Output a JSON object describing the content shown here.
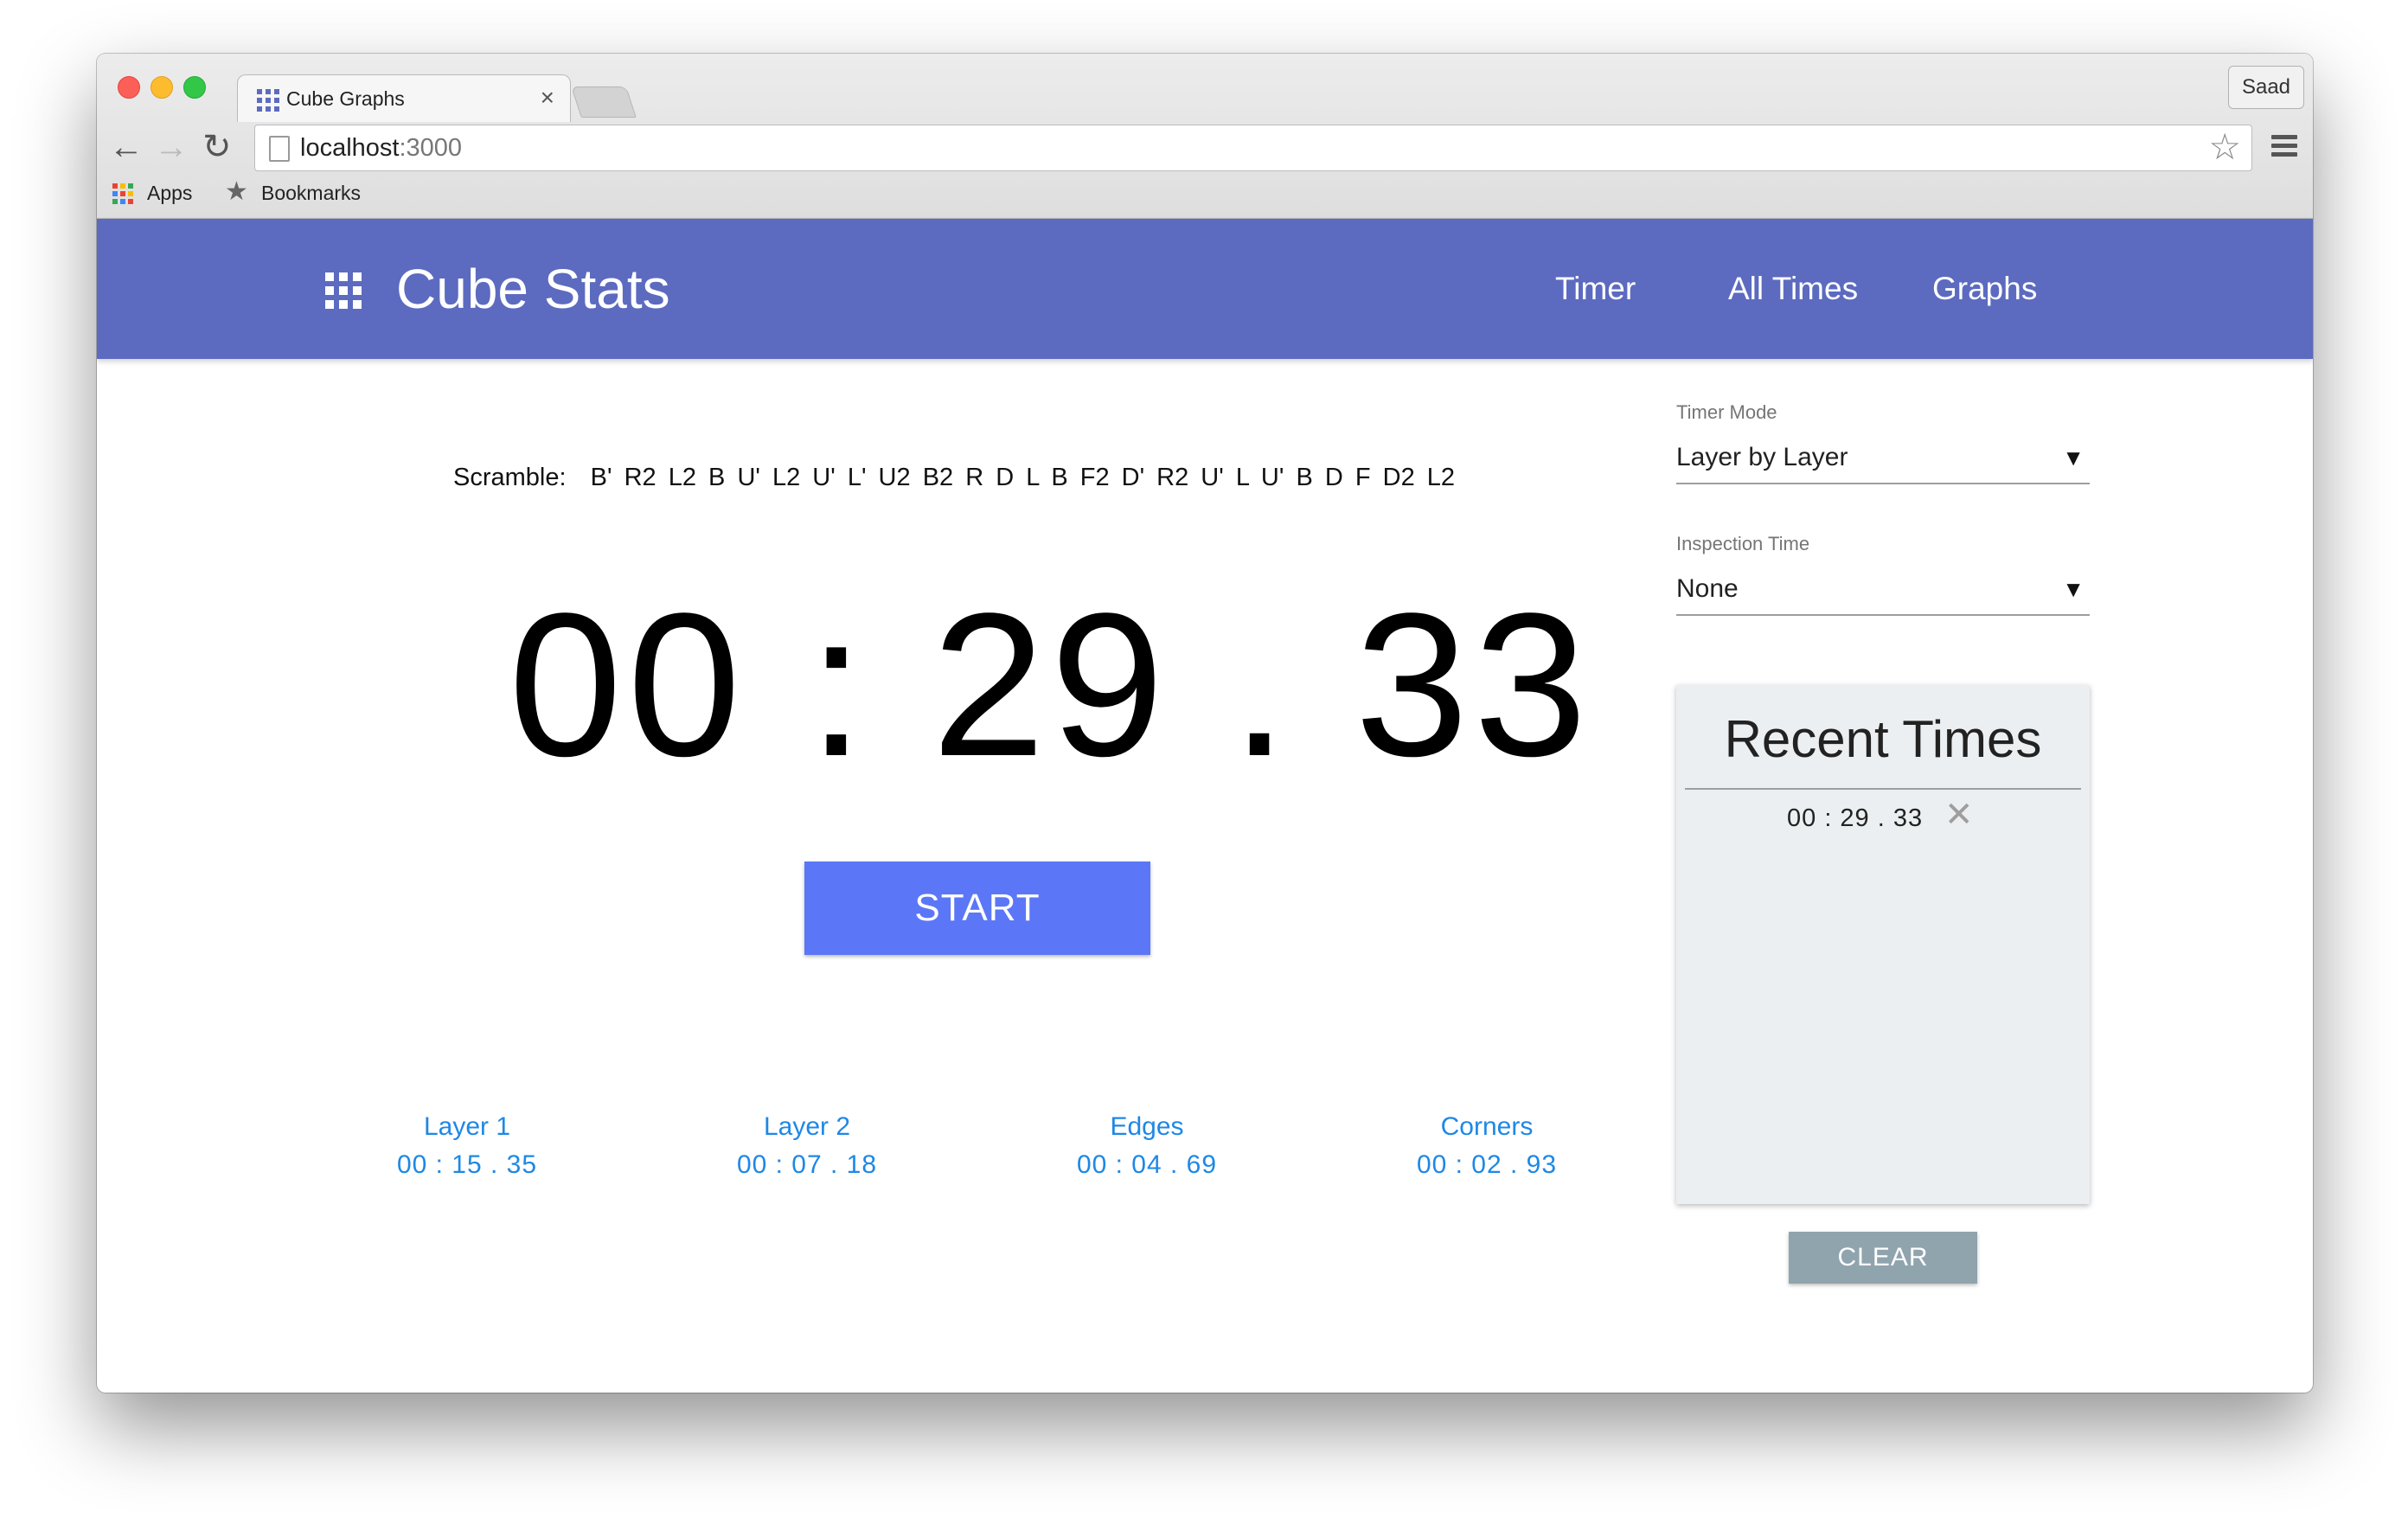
{
  "browser": {
    "tab_title": "Cube Graphs",
    "tab_close": "×",
    "profile_name": "Saad",
    "url_host": "localhost",
    "url_port": ":3000",
    "bookmarks": [
      {
        "label": "Apps",
        "icon": "apps-grid-icon"
      },
      {
        "label": "Bookmarks",
        "icon": "star-icon"
      }
    ],
    "nav_icons": {
      "back": "←",
      "forward": "→",
      "reload": "↻",
      "star": "☆"
    }
  },
  "appbar": {
    "brand": "Cube Stats",
    "nav": [
      "Timer",
      "All Times",
      "Graphs"
    ],
    "color": "#5c6bc0"
  },
  "timer": {
    "scramble_label": "Scramble:",
    "scramble": "B' R2 L2 B U' L2 U' L' U2 B2 R D L B F2 D' R2 U' L U' B D F D2 L2",
    "display": "00 : 29 . 33",
    "start_label": "START",
    "start_color": "#5b77f7"
  },
  "splits": [
    {
      "label": "Layer 1",
      "time": "00 : 15 . 35"
    },
    {
      "label": "Layer 2",
      "time": "00 : 07 . 18"
    },
    {
      "label": "Edges",
      "time": "00 : 04 . 69"
    },
    {
      "label": "Corners",
      "time": "00 : 02 . 93"
    }
  ],
  "settings": {
    "timer_mode_label": "Timer Mode",
    "timer_mode_value": "Layer by Layer",
    "inspection_label": "Inspection Time",
    "inspection_value": "None",
    "dropdown_arrow": "▼"
  },
  "recent": {
    "title": "Recent Times",
    "items": [
      {
        "time": "00 : 29 . 33",
        "remove": "✕"
      }
    ],
    "clear_label": "CLEAR"
  }
}
